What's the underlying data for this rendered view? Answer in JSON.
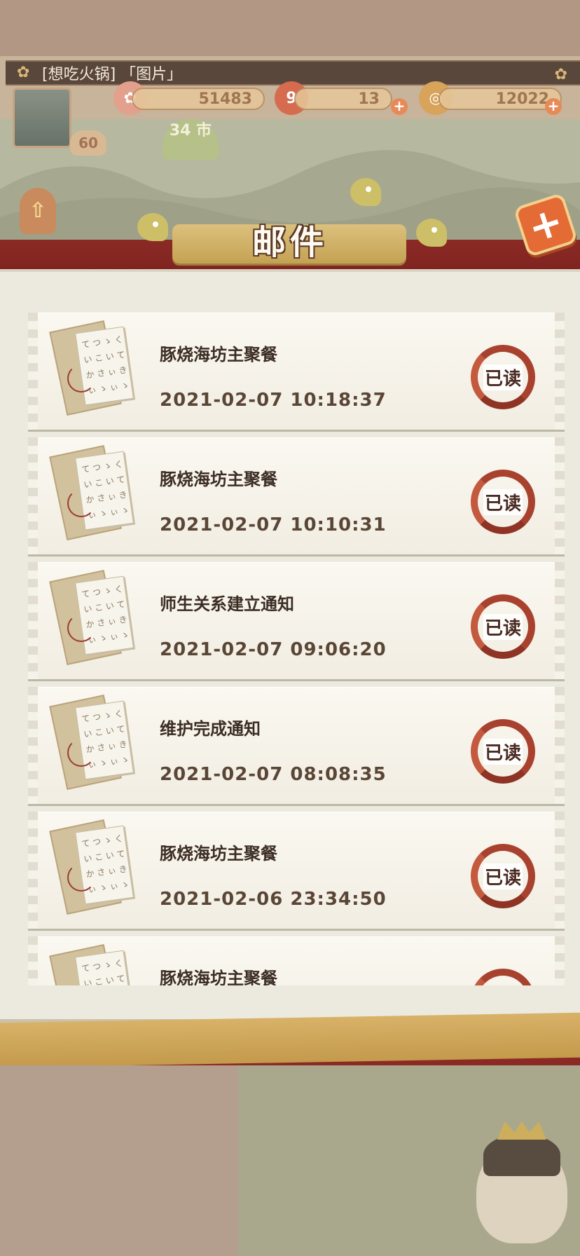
{
  "chat": {
    "message": "[想吃火锅] 「图片」"
  },
  "header": {
    "resource_1": "51483",
    "resource_2": "13",
    "resource_3": "12022",
    "level": "60",
    "leaf_badge": "34 市",
    "close_icon": "plus-close-icon"
  },
  "page": {
    "title": "邮件"
  },
  "mails": [
    {
      "subject": "豚烧海坊主聚餐",
      "time": "2021-02-07 10:18:37",
      "status": "已读"
    },
    {
      "subject": "豚烧海坊主聚餐",
      "time": "2021-02-07 10:10:31",
      "status": "已读"
    },
    {
      "subject": "师生关系建立通知",
      "time": "2021-02-07 09:06:20",
      "status": "已读"
    },
    {
      "subject": "维护完成通知",
      "time": "2021-02-07 08:08:35",
      "status": "已读"
    },
    {
      "subject": "豚烧海坊主聚餐",
      "time": "2021-02-06 23:34:50",
      "status": "已读"
    },
    {
      "subject": "豚烧海坊主聚餐",
      "time": "",
      "status": ""
    }
  ],
  "colors": {
    "accent_red": "#8b2a25",
    "gold": "#d8b268",
    "panel": "#eceadf"
  }
}
